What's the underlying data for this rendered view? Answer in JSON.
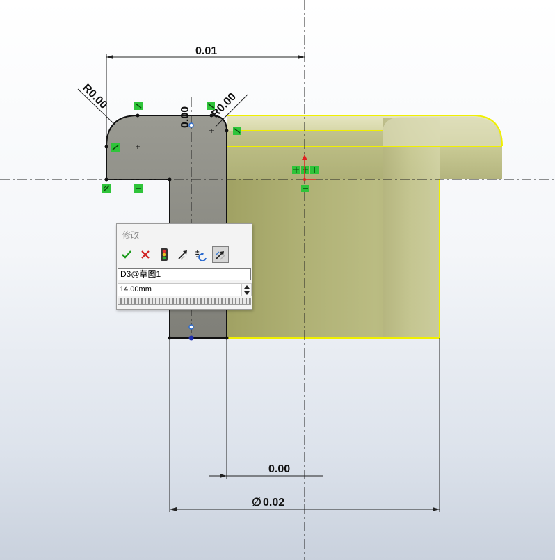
{
  "dimensions": {
    "top_width": "0.01",
    "radius_left": "R0.00",
    "radius_right": "R0.00",
    "vertical_small": "0.00",
    "bottom_offset": "0.00",
    "diameter": "0.02",
    "diameter_symbol": "∅"
  },
  "dialog": {
    "title": "修改",
    "name_value": "D3@草图1",
    "numeric_value": "14.00mm",
    "buttons": {
      "ok": "check-icon",
      "cancel": "x-icon",
      "rebuild": "traffic-light-icon",
      "reverse": "reverse-direction-icon",
      "increment": "increment-icon",
      "mark": "mark-dimension-icon"
    }
  },
  "colors": {
    "sketch_profile": "#8a8a82",
    "model_body": "#c8c990",
    "highlight_edge": "#f0f000",
    "relation_green": "#2fc43a",
    "ok_green": "#1a9a1a",
    "cancel_red": "#d02020"
  }
}
